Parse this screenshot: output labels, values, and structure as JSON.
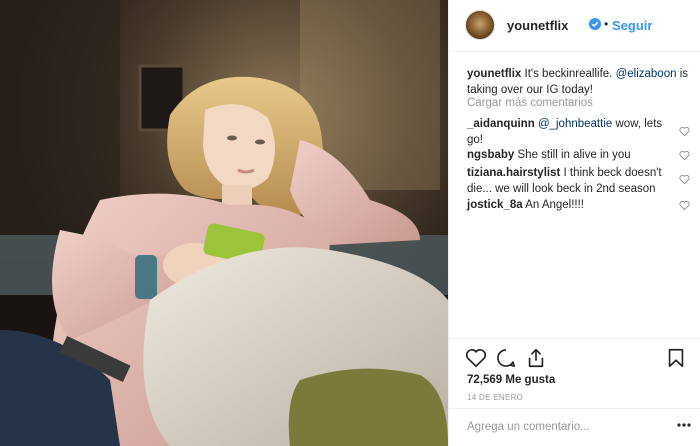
{
  "post": {
    "username": "younetflix",
    "follow_label": "Seguir",
    "separator": "•",
    "caption": {
      "user": "younetflix",
      "text_a": "It's beckinreallife.",
      "mention": "@elizaboon",
      "text_b": "is taking over our IG today!"
    },
    "load_more": "Cargar más comentarios",
    "comments": [
      {
        "user": "_aidanquinn",
        "mention": "@_johnbeattie",
        "text": "wow, lets go!"
      },
      {
        "user": "ngsbaby",
        "mention": "",
        "text": "She still in alive in you"
      },
      {
        "user": "tiziana.hairstylist",
        "mention": "",
        "text": "I think beck doesn't die... we will look beck in 2nd season"
      },
      {
        "user": "jostick_8a",
        "mention": "",
        "text": "An Angel!!!!"
      }
    ],
    "likes": "72,569 Me gusta",
    "date": "14 DE ENERO",
    "comment_placeholder": "Agrega un comentario...",
    "icons": [
      "heart-icon",
      "comment-icon",
      "share-icon",
      "bookmark-icon",
      "verified-badge-icon",
      "more-options-icon"
    ],
    "colors": {
      "accent": "#3897f0",
      "mention": "#003569",
      "muted": "#999999",
      "text": "#262626"
    }
  }
}
